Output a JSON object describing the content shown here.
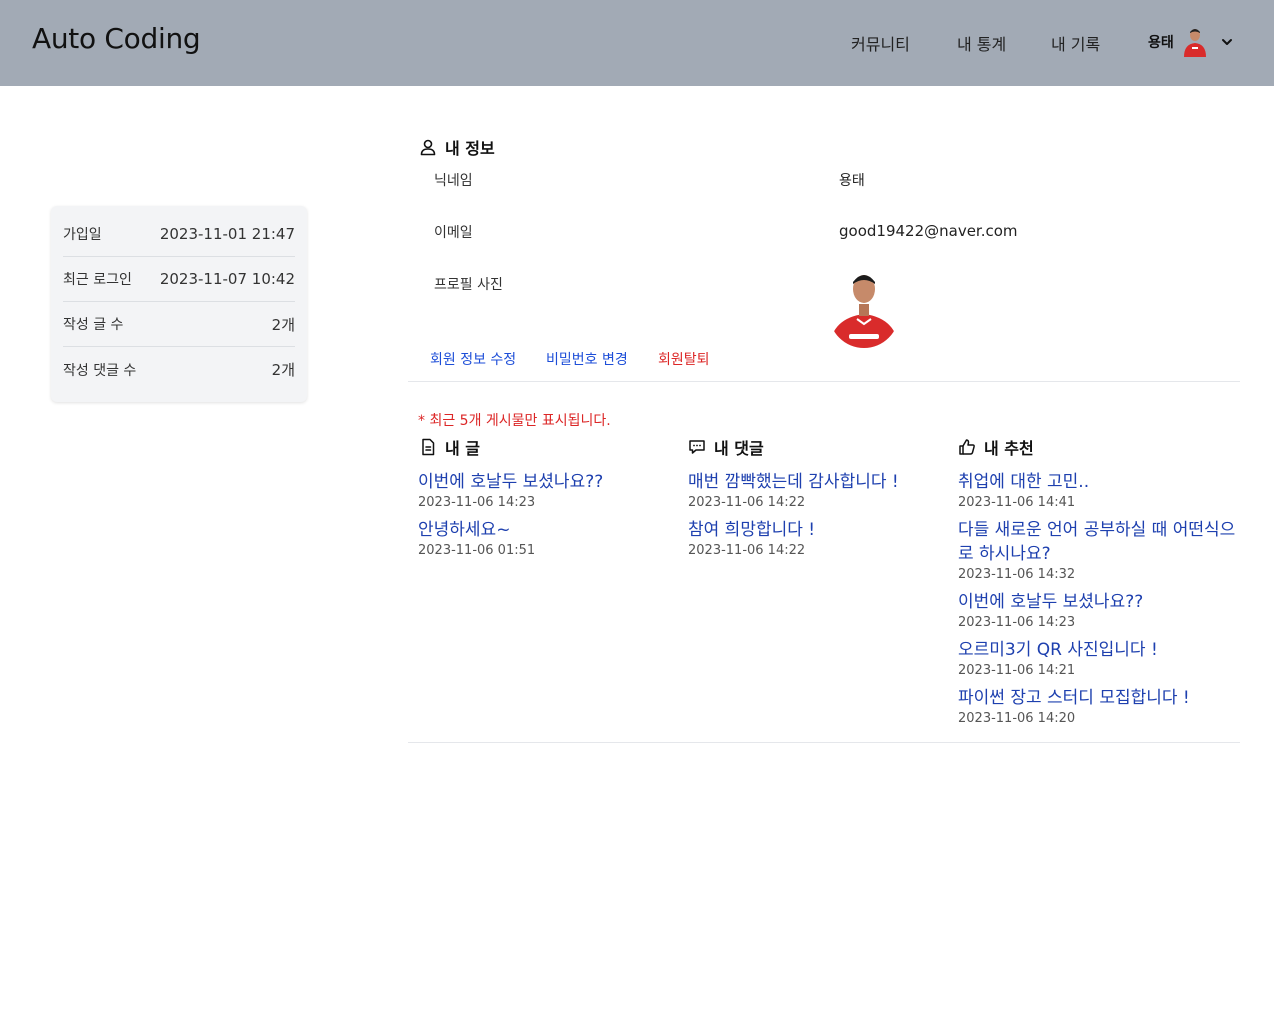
{
  "header": {
    "brand": "Auto Coding",
    "nav": [
      "커뮤니티",
      "내 통계",
      "내 기록"
    ],
    "user_name": "용태"
  },
  "stats": [
    {
      "label": "가입일",
      "value": "2023-11-01 21:47"
    },
    {
      "label": "최근 로그인",
      "value": "2023-11-07 10:42"
    },
    {
      "label": "작성 글 수",
      "value": "2개"
    },
    {
      "label": "작성 댓글 수",
      "value": "2개"
    }
  ],
  "profile": {
    "title": "내 정보",
    "nickname_label": "닉네임",
    "nickname": "용태",
    "email_label": "이메일",
    "email": "good19422@naver.com",
    "photo_label": "프로필 사진",
    "actions": {
      "edit": "회원 정보 수정",
      "password": "비밀번호 변경",
      "withdraw": "회원탈퇴"
    }
  },
  "notice": "* 최근 5개 게시물만 표시됩니다.",
  "my_posts": {
    "title": "내 글",
    "items": [
      {
        "title": "이번에 호날두 보셨나요??",
        "date": "2023-11-06 14:23"
      },
      {
        "title": "안녕하세요~",
        "date": "2023-11-06 01:51"
      }
    ]
  },
  "my_comments": {
    "title": "내 댓글",
    "items": [
      {
        "title": "매번 깜빡했는데 감사합니다 !",
        "date": "2023-11-06 14:22"
      },
      {
        "title": "참여 희망합니다 !",
        "date": "2023-11-06 14:22"
      }
    ]
  },
  "my_likes": {
    "title": "내 추천",
    "items": [
      {
        "title": "취업에 대한 고민..",
        "date": "2023-11-06 14:41"
      },
      {
        "title": "다들 새로운 언어 공부하실 때 어떤식으로 하시나요?",
        "date": "2023-11-06 14:32"
      },
      {
        "title": "이번에 호날두 보셨나요??",
        "date": "2023-11-06 14:23"
      },
      {
        "title": "오르미3기 QR 사진입니다 !",
        "date": "2023-11-06 14:21"
      },
      {
        "title": "파이썬 장고 스터디 모집합니다 !",
        "date": "2023-11-06 14:20"
      }
    ]
  },
  "colors": {
    "header_bg": "#a2aab5",
    "link": "#1e40af",
    "danger": "#dc2626",
    "card_bg": "#f3f4f6"
  }
}
